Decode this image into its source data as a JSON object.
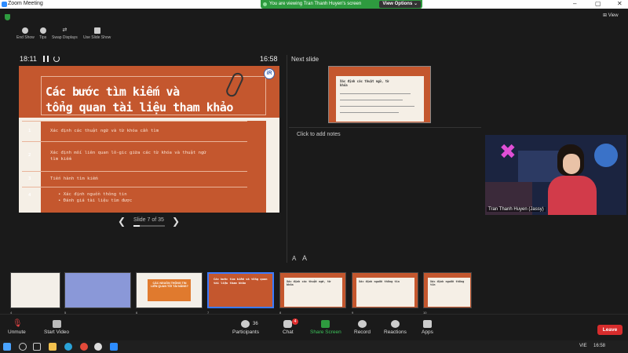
{
  "titlebar": {
    "app_title": "Zoom Meeting",
    "minimize": "–",
    "maximize": "▢",
    "close": "✕"
  },
  "banner": {
    "text": "You are viewing Tran Thanh Huyen's screen",
    "options": "View Options ⌄"
  },
  "view_button": "⊞ View",
  "presenter_tools": [
    {
      "label": "End Show"
    },
    {
      "label": "Tips"
    },
    {
      "label": "Swap Displays"
    },
    {
      "label": "Use Slide Show"
    }
  ],
  "timer": "18:11",
  "clock": "16:58",
  "slide": {
    "title_line1": "Các bước tìm kiếm và",
    "title_line2": "tổng quan tài liệu tham khảo",
    "logo": "iR",
    "rows": [
      {
        "num": "1",
        "lines": [
          "Xác định các thuật ngữ và từ khóa cần tìm"
        ]
      },
      {
        "num": "2",
        "lines": [
          "Xác định mối liên quan lô-gic giữa các từ khóa và thuật ngữ",
          "tìm kiếm"
        ]
      },
      {
        "num": "3",
        "lines": [
          "Tiến hành tìm kiếm"
        ]
      },
      {
        "num": "4",
        "lines": [
          "• Xác định nguồn thông tin",
          "• Đánh giá tài liệu tìm được"
        ]
      }
    ]
  },
  "slide_nav": {
    "counter": "Slide 7 of 35",
    "prev": "❮",
    "next": "❯",
    "progress": 0.2
  },
  "next_slide": {
    "label": "Next slide",
    "thumb_title": "Xác định các thuật ngữ, từ khóa"
  },
  "notes_placeholder": "Click to add notes",
  "font_controls": {
    "decrease": "A",
    "increase": "A"
  },
  "video": {
    "name": "Tran Thanh Huyen (Jassy)"
  },
  "filmstrip": [
    {
      "num": "4",
      "caption": ""
    },
    {
      "num": "5",
      "caption": ""
    },
    {
      "num": "6",
      "caption": "CÁC NGUỒN THÔNG TIN LIÊN QUAN TỚI TÀI NĂNG?"
    },
    {
      "num": "7",
      "caption": "Các bước tìm kiếm và tổng quan tài liệu tham khảo"
    },
    {
      "num": "8",
      "caption": "Xác định các thuật ngữ, từ khóa"
    },
    {
      "num": "9",
      "caption": "Xác định nguồn thông tin"
    },
    {
      "num": "10",
      "caption": "Xác định nguồn thông tin"
    }
  ],
  "toolbar": {
    "unmute": "Unmute",
    "start_video": "Start Video",
    "participants": "Participants",
    "participants_count": "36",
    "chat": "Chat",
    "chat_badge": "4",
    "share_screen": "Share Screen",
    "record": "Record",
    "reactions": "Reactions",
    "apps": "Apps",
    "leave": "Leave"
  },
  "taskbar": {
    "lang": "VIE",
    "time": "16:58"
  },
  "colors": {
    "slide_orange": "#c4572e",
    "share_green": "#2e9b3f",
    "leave_red": "#d72c2c",
    "accent_blue": "#3b7bff"
  }
}
